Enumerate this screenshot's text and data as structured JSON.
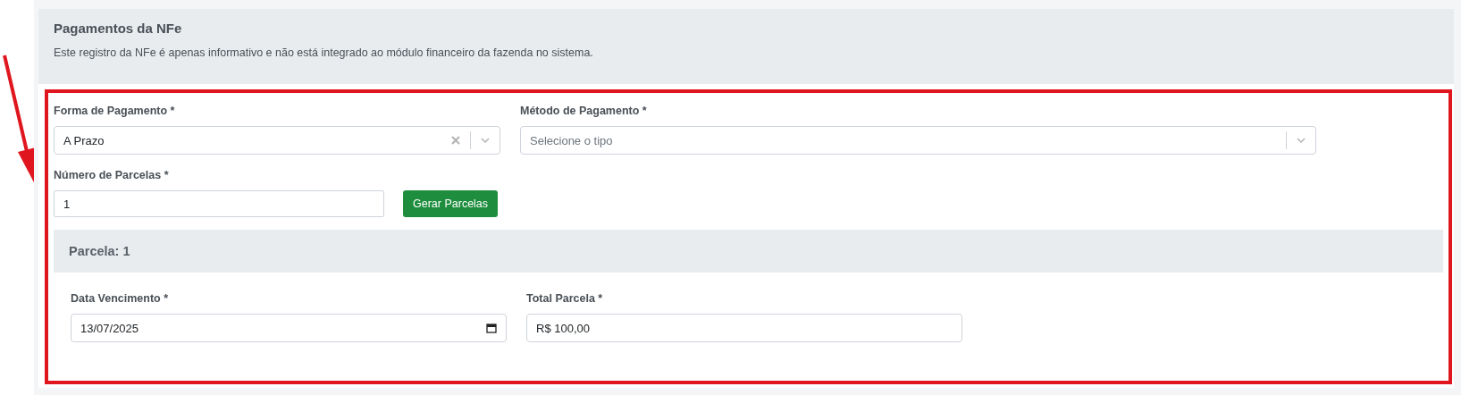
{
  "card": {
    "title": "Pagamentos da NFe",
    "description": "Este registro da NFe é apenas informativo e não está integrado ao módulo financeiro da fazenda no sistema."
  },
  "payment_form": {
    "label": "Forma de Pagamento *",
    "value": "A Prazo",
    "clearable": true
  },
  "payment_method": {
    "label": "Método de Pagamento *",
    "placeholder": "Selecione o tipo",
    "clearable": false
  },
  "installments": {
    "label": "Número de Parcelas *",
    "value": "1",
    "button": "Gerar Parcelas"
  },
  "parcels": [
    {
      "title": "Parcela: 1",
      "due_label": "Data Vencimento *",
      "due_value": "13/07/2025",
      "total_label": "Total Parcela *",
      "total_value": "R$ 100,00"
    }
  ]
}
